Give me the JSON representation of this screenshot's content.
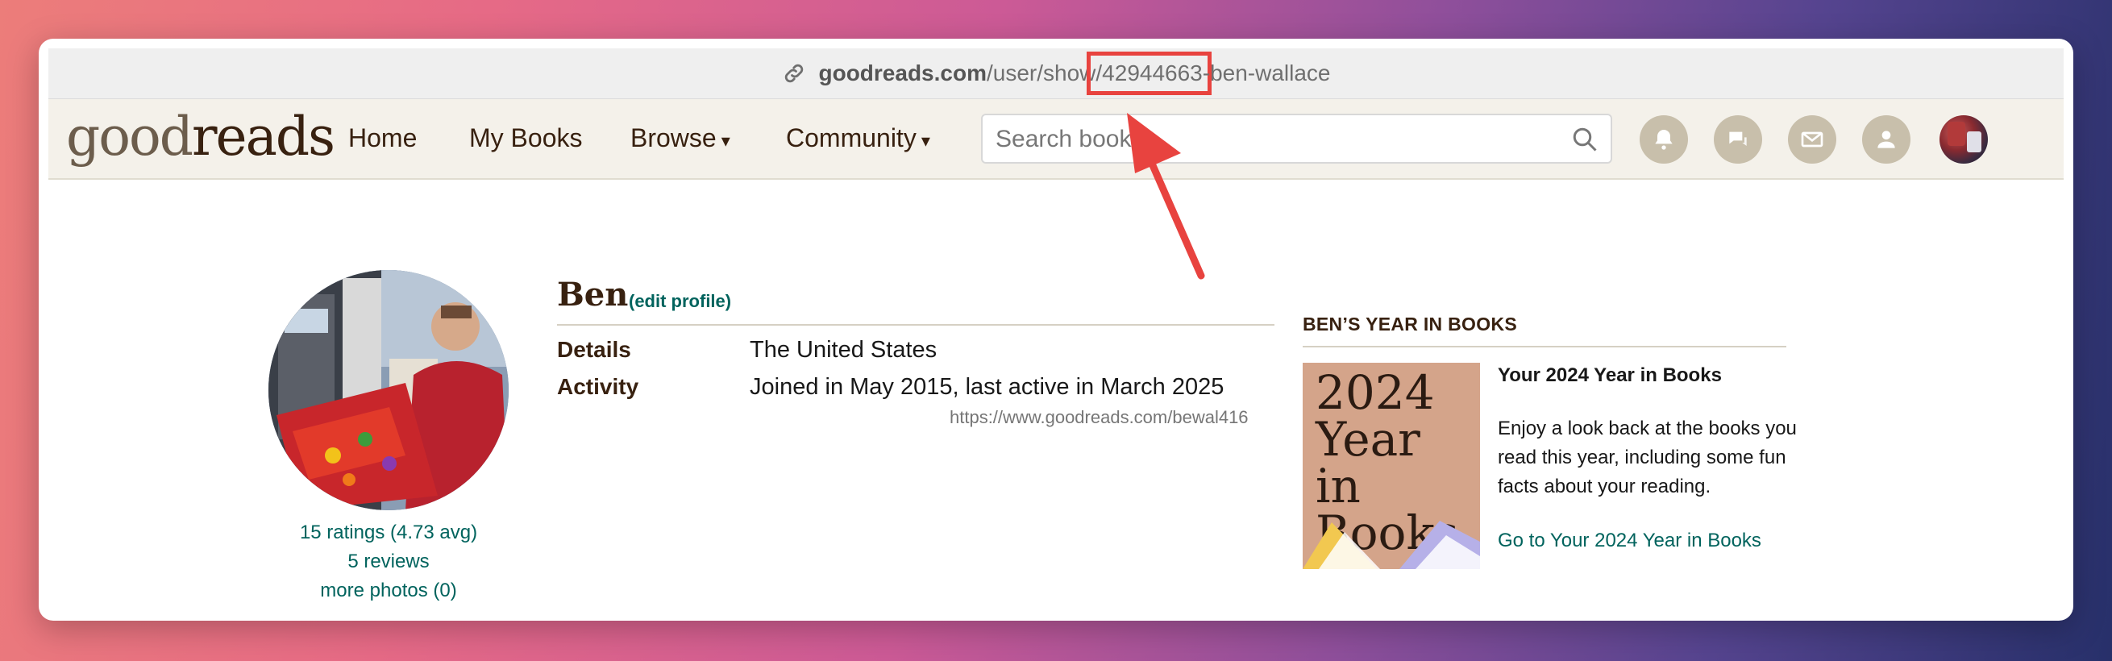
{
  "browser": {
    "url_domain": "goodreads.com",
    "url_path_pre": "/user/show",
    "url_path_id": "/42944663",
    "url_path_post": "-ben-wallace"
  },
  "nav": {
    "logo_light": "good",
    "logo_bold": "reads",
    "home": "Home",
    "my_books": "My Books",
    "browse": "Browse",
    "community": "Community",
    "search_placeholder": "Search books"
  },
  "profile": {
    "name": "Ben",
    "edit_link": "(edit profile)",
    "details_label": "Details",
    "details_value": "The United States",
    "activity_label": "Activity",
    "activity_value": "Joined in May 2015, last active in March 2025",
    "profile_url": "https://www.goodreads.com/bewal416",
    "ratings": "15 ratings (4.73 avg)",
    "reviews": "5 reviews",
    "more_photos": "more photos (0)"
  },
  "year_in_books": {
    "heading": "BEN’S YEAR IN BOOKS",
    "image_line1": "2024",
    "image_line2": "Year in",
    "image_line3": "Books",
    "title": "Your 2024 Year in Books",
    "body": "Enjoy a look back at the books you read this year, including some fun facts about your reading.",
    "link": "Go to Your 2024 Year in Books"
  },
  "colors": {
    "highlight": "#e8433f",
    "brand_brown": "#382110",
    "link_green": "#00635d",
    "nav_bg": "#f4f1ea"
  }
}
